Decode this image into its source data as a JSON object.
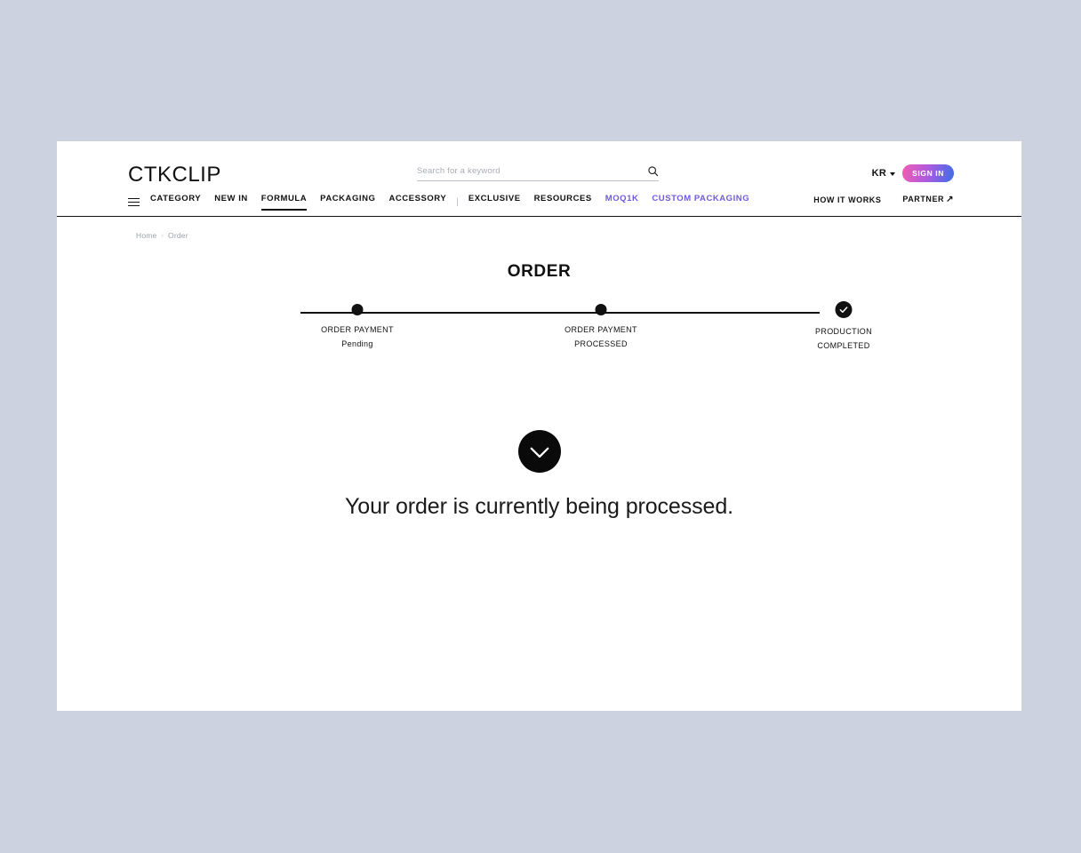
{
  "brand": {
    "logo": "CTKCLIP"
  },
  "search": {
    "placeholder": "Search for a keyword",
    "value": "",
    "icon": "search-icon"
  },
  "account": {
    "language": "KR",
    "signin_label": "SIGN IN"
  },
  "nav": {
    "primary": [
      {
        "label": "CATEGORY",
        "style": "dark",
        "active": false
      },
      {
        "label": "NEW IN",
        "style": "dark",
        "active": false
      },
      {
        "label": "FORMULA",
        "style": "dark",
        "active": true
      },
      {
        "label": "PACKAGING",
        "style": "dark",
        "active": false
      },
      {
        "label": "ACCESSORY",
        "style": "dark",
        "active": false
      },
      {
        "label": "EXCLUSIVE",
        "style": "dark",
        "active": false
      },
      {
        "label": "RESOURCES",
        "style": "dark",
        "active": false
      },
      {
        "label": "MOQ1K",
        "style": "purple",
        "active": false
      },
      {
        "label": "CUSTOM PACKAGING",
        "style": "purple",
        "active": false
      }
    ],
    "separator": "|",
    "secondary": [
      {
        "label": "HOW IT WORKS"
      },
      {
        "label": "PARTNER",
        "icon": "arrow-up-right-icon"
      }
    ]
  },
  "breadcrumb": {
    "items": [
      "Home",
      "Order"
    ],
    "separator": "›"
  },
  "page_title": "ORDER",
  "stepper": {
    "steps": [
      {
        "line1": "ORDER PAYMENT",
        "line2": "Pending",
        "state": "active"
      },
      {
        "line1": "ORDER PAYMENT",
        "line2": "PROCESSED",
        "state": "active"
      },
      {
        "line1": "PRODUCTION",
        "line2": "COMPLETED",
        "state": "done"
      }
    ]
  },
  "result": {
    "icon": "check-circle-icon",
    "message": "Your order is currently being processed."
  },
  "colors": {
    "accent_purple": "#6f5ae0",
    "signin_gradient_start": "#f25cb0",
    "signin_gradient_end": "#3a6ee8",
    "ink": "#111111",
    "page_background": "#ccd2e0"
  }
}
